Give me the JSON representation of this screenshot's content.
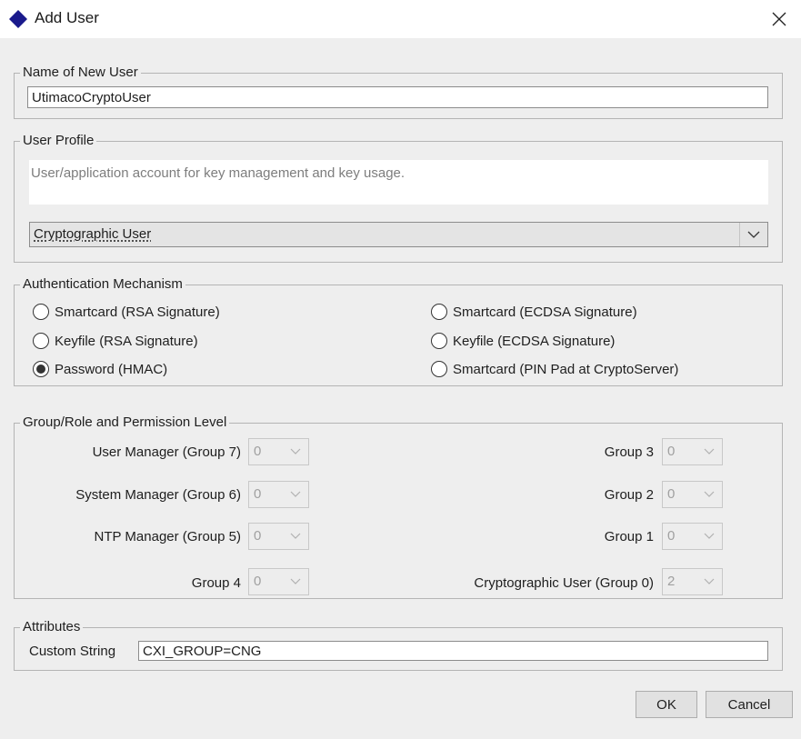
{
  "window": {
    "title": "Add User",
    "close_icon": "close-icon"
  },
  "new_user": {
    "legend": "Name of New User",
    "value": "UtimacoCryptoUser"
  },
  "profile": {
    "legend": "User Profile",
    "description": "User/application account for key management and key usage.",
    "selected": "Cryptographic User"
  },
  "auth": {
    "legend": "Authentication Mechanism",
    "options": [
      {
        "label": "Smartcard (RSA Signature)",
        "checked": false
      },
      {
        "label": "Keyfile (RSA Signature)",
        "checked": false
      },
      {
        "label": "Password (HMAC)",
        "checked": true
      },
      {
        "label": "Smartcard (ECDSA Signature)",
        "checked": false
      },
      {
        "label": "Keyfile (ECDSA Signature)",
        "checked": false
      },
      {
        "label": "Smartcard (PIN Pad at CryptoServer)",
        "checked": false
      }
    ]
  },
  "permissions": {
    "legend": "Group/Role and Permission Level",
    "left": [
      {
        "label": "User Manager (Group 7)",
        "value": "0"
      },
      {
        "label": "System Manager (Group 6)",
        "value": "0"
      },
      {
        "label": "NTP Manager (Group 5)",
        "value": "0"
      },
      {
        "label": "Group 4",
        "value": "0"
      }
    ],
    "right": [
      {
        "label": "Group 3",
        "value": "0"
      },
      {
        "label": "Group 2",
        "value": "0"
      },
      {
        "label": "Group 1",
        "value": "0"
      },
      {
        "label": "Cryptographic User (Group 0)",
        "value": "2"
      }
    ]
  },
  "attributes": {
    "legend": "Attributes",
    "custom_label": "Custom String",
    "custom_value": "CXI_GROUP=CNG"
  },
  "buttons": {
    "ok": "OK",
    "cancel": "Cancel"
  },
  "colors": {
    "app_icon": "#1a1a8c",
    "dialog_bg": "#eeeeee",
    "titlebar_bg": "#ffffff"
  }
}
